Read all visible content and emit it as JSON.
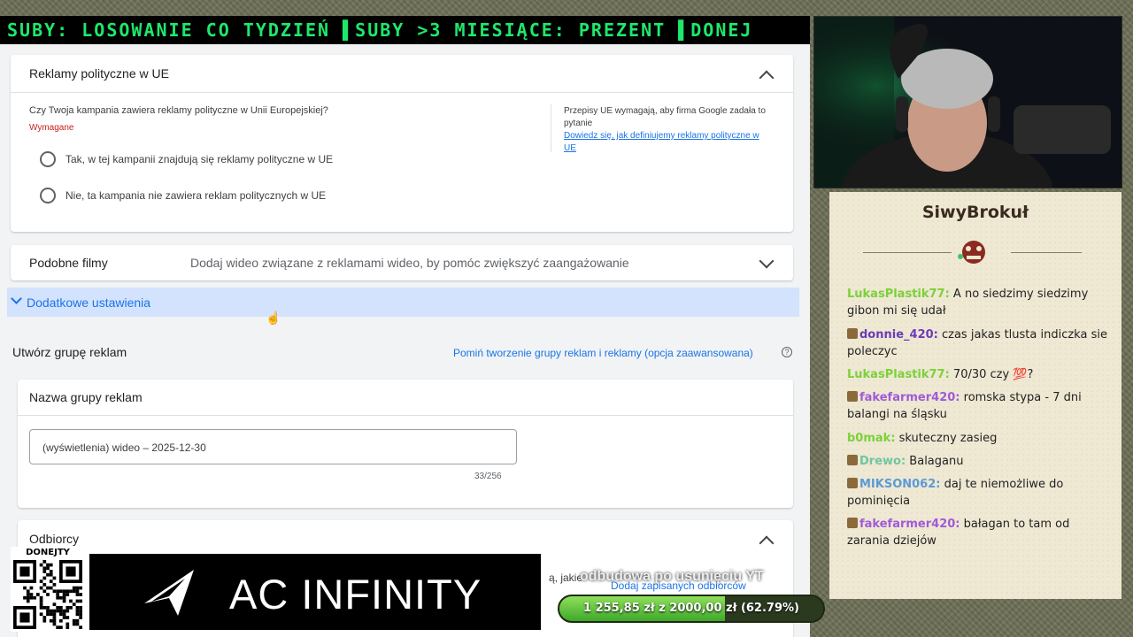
{
  "ticker": {
    "text": "SUBY: LOSOWANIE CO TYDZIEŃ ▌SUBY >3 MIESIĄCE: PREZENT ▌DONEJ"
  },
  "political": {
    "title": "Reklamy polityczne w UE",
    "question": "Czy Twoja kampania zawiera reklamy polityczne w Unii Europejskiej?",
    "required": "Wymagane",
    "option_yes": "Tak, w tej kampanii znajdują się reklamy polityczne w UE",
    "option_no": "Nie, ta kampania nie zawiera reklam politycznych w UE",
    "side_note": "Przepisy UE wymagają, aby firma Google zadała to pytanie",
    "side_link": "Dowiedz się, jak definiujemy reklamy polityczne w UE"
  },
  "similar": {
    "title": "Podobne filmy",
    "description": "Dodaj wideo związane z reklamami wideo, by pomóc zwiększyć zaangażowanie"
  },
  "additional": {
    "label": "Dodatkowe ustawienia"
  },
  "adgroup": {
    "heading": "Utwórz grupę reklam",
    "skip_link": "Pomiń tworzenie grupy reklam i reklamy (opcja zaawansowana)",
    "help": "?",
    "name_title": "Nazwa grupy reklam",
    "name_value": "(wyświetlenia) wideo – 2025-12-30",
    "char_count": "33/256"
  },
  "audience": {
    "title": "Odbiorcy",
    "partial_text": "ą, jakie",
    "add_saved": "Dodaj zapisanych odbiorców"
  },
  "overlay_caption": "odbudowa po usunięciu YT",
  "qr": {
    "label": "DONEJTY"
  },
  "ad_banner": {
    "brand": "AC INFINITY"
  },
  "progress": {
    "text": "1 255,85 zł z 2000,00 zł (62.79%)",
    "fraction": 0.6279
  },
  "chat": {
    "title": "SiwyBrokuł",
    "messages": [
      {
        "user": "LukasPlastik77:",
        "text": "A no siedzimy siedzimy gibon mi się udał",
        "color": "#7bd13a",
        "badge": false
      },
      {
        "user": "donnie_420:",
        "text": "czas jakas tlusta indiczka sie poleczyc",
        "color": "#6a3db8",
        "badge": true
      },
      {
        "user": "LukasPlastik77:",
        "text": "70/30 czy 💯?",
        "color": "#7bd13a",
        "badge": false
      },
      {
        "user": "fakefarmer420:",
        "text": "romska stypa - 7 dni balangi na śląsku",
        "color": "#a05ad8",
        "badge": true
      },
      {
        "user": "b0mak:",
        "text": "skuteczny zasieg",
        "color": "#7bd13a",
        "badge": false
      },
      {
        "user": "Drewo:",
        "text": "Balaganu",
        "color": "#6fc6a0",
        "badge": true
      },
      {
        "user": "MIKSON062:",
        "text": "daj te niemożliwe do pominięcia",
        "color": "#5a9ad8",
        "badge": true
      },
      {
        "user": "fakefarmer420:",
        "text": "bałagan to tam od zarania dziejów",
        "color": "#a05ad8",
        "badge": true
      }
    ]
  }
}
